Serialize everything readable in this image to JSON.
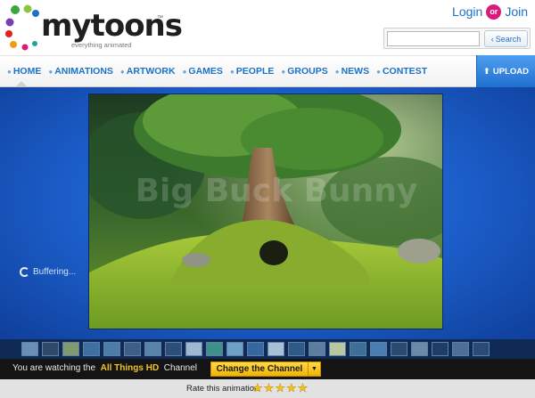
{
  "site": {
    "logo_text": "mytoons",
    "tm": "™",
    "tagline": "everything animated"
  },
  "account": {
    "login": "Login",
    "or": "or",
    "join": "Join"
  },
  "search": {
    "value": "",
    "button_label": "Search",
    "button_icon": "chevron-left-icon"
  },
  "nav": {
    "items": [
      "HOME",
      "ANIMATIONS",
      "ARTWORK",
      "GAMES",
      "PEOPLE",
      "GROUPS",
      "NEWS",
      "CONTEST"
    ],
    "active": "HOME",
    "upload_label": "UPLOAD"
  },
  "player": {
    "buffering_label": "Buffering...",
    "watermark": "Big Buck Bunny"
  },
  "thumbnails": {
    "count": 23
  },
  "channel": {
    "prefix": "You are watching the",
    "name": "All Things HD",
    "suffix": "Channel",
    "change_label": "Change the Channel",
    "dropdown_icon": "triangle-down-icon"
  },
  "rating": {
    "label": "Rate this animation",
    "stars": 5
  },
  "colors": {
    "link_blue": "#1b73c7",
    "player_blue": "#1b5cc7",
    "or_magenta": "#d91a7a",
    "channel_yellow": "#f2c229"
  }
}
